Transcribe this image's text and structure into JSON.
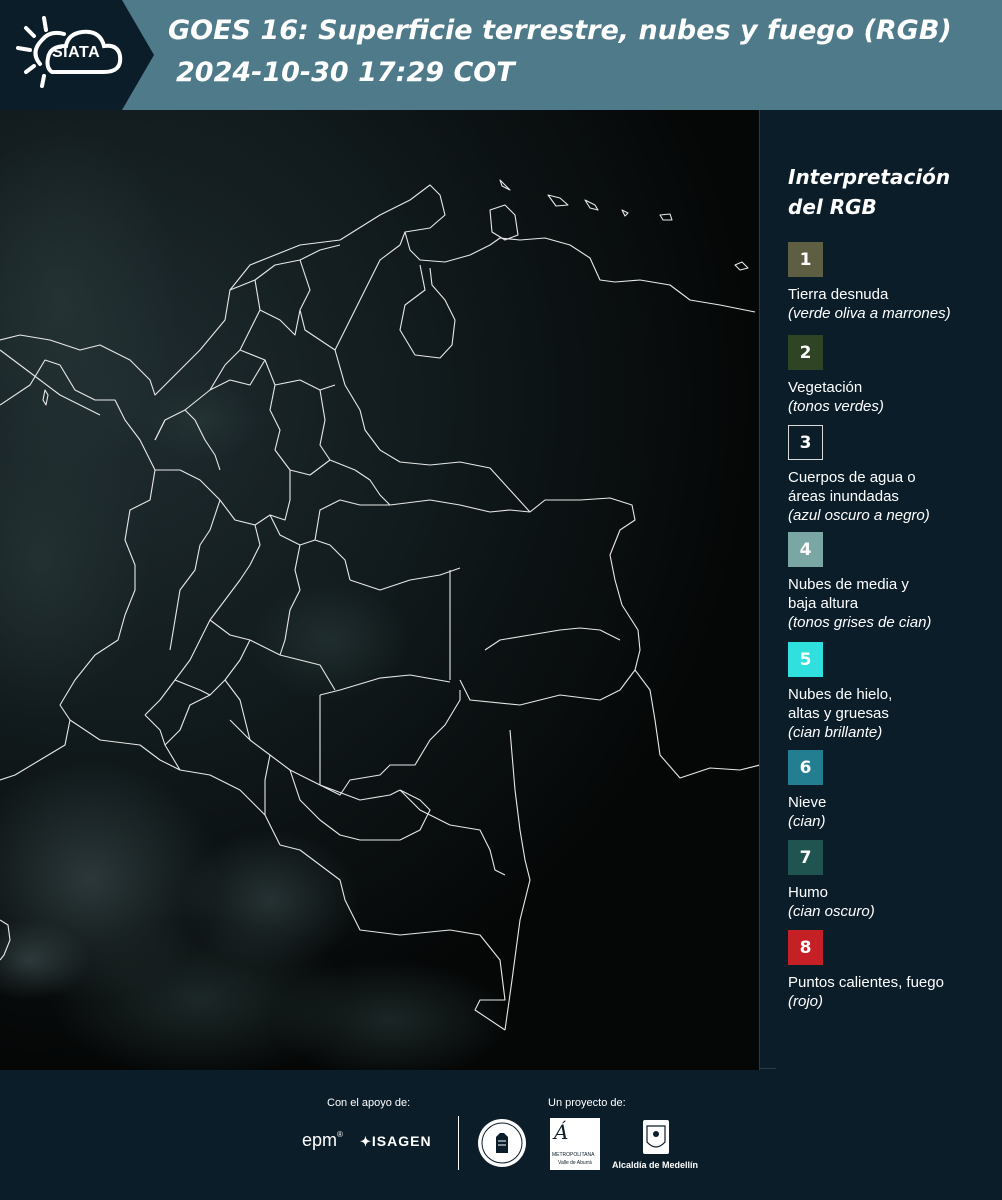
{
  "header": {
    "logo_text": "SIATA",
    "title_line1": "GOES 16: Superficie terrestre, nubes y fuego (RGB)",
    "title_line2": "2024-10-30 17:29 COT"
  },
  "legend": {
    "title_line1": "Interpretación",
    "title_line2": "del RGB",
    "items": [
      {
        "number": "1",
        "color": "#5e5f42",
        "label_lines": [
          "Tierra desnuda"
        ],
        "desc": "(verde oliva a marrones)"
      },
      {
        "number": "2",
        "color": "#2e4424",
        "label_lines": [
          "Vegetación"
        ],
        "desc": "(tonos verdes)"
      },
      {
        "number": "3",
        "color": "#0b1d29",
        "label_lines": [
          "Cuerpos de agua o",
          "áreas inundadas"
        ],
        "desc": "(azul oscuro a negro)"
      },
      {
        "number": "4",
        "color": "#7aa7a4",
        "label_lines": [
          "Nubes de media y",
          "baja altura"
        ],
        "desc": "(tonos grises de cian)"
      },
      {
        "number": "5",
        "color": "#2fe0de",
        "label_lines": [
          "Nubes de hielo,",
          "altas y gruesas"
        ],
        "desc": "(cian brillante)"
      },
      {
        "number": "6",
        "color": "#237e92",
        "label_lines": [
          "Nieve"
        ],
        "desc": "(cian)"
      },
      {
        "number": "7",
        "color": "#1f5450",
        "label_lines": [
          "Humo"
        ],
        "desc": "(cian oscuro)"
      },
      {
        "number": "8",
        "color": "#c42026",
        "label_lines": [
          "Puntos calientes, fuego"
        ],
        "desc": "(rojo)"
      }
    ]
  },
  "footer": {
    "support_label": "Con el apoyo de:",
    "project_label": "Un proyecto de:",
    "sponsors": [
      "epm",
      "ISAGEN"
    ],
    "partners": [
      "Área Metropolitana",
      "Alcaldía de Medellín"
    ],
    "area_sub1": "METROPOLITANA",
    "area_sub2": "Valle de Aburrá",
    "alcaldia": "Alcaldía de Medellín"
  }
}
